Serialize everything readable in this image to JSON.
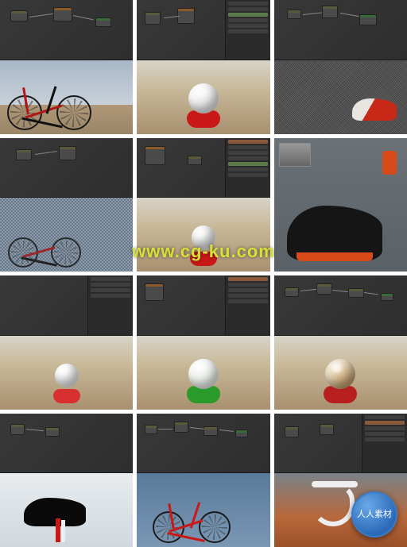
{
  "watermark_text": "www.cg-ku.com",
  "badge_text": "人人素材",
  "cells": [
    {
      "id": "r1c1",
      "desc": "node-editor-bike-render-desert"
    },
    {
      "id": "r1c2",
      "desc": "node-editor-shaderball-red-white"
    },
    {
      "id": "r1c3",
      "desc": "node-editor-bike-saddle-noise"
    },
    {
      "id": "r2c1",
      "desc": "node-editor-bike-pixelated"
    },
    {
      "id": "r2c2",
      "desc": "node-editor-shaderball-red-white-panel"
    },
    {
      "id": "r2c3",
      "desc": "bike-saddle-closeup-black-orange"
    },
    {
      "id": "r3c1",
      "desc": "node-editor-shaderball-white"
    },
    {
      "id": "r3c2",
      "desc": "node-editor-shaderball-green"
    },
    {
      "id": "r3c3",
      "desc": "node-editor-shaderball-tan-metallic"
    },
    {
      "id": "r4c1",
      "desc": "node-editor-saddle-white-red"
    },
    {
      "id": "r4c2",
      "desc": "node-editor-bike-full-red"
    },
    {
      "id": "r4c3",
      "desc": "node-editor-handlebar-white"
    }
  ],
  "shader_balls": {
    "r1c2": {
      "ball_color": "#f0f0f0",
      "stand_color": "#c81818"
    },
    "r2c2": {
      "ball_color": "#f0f0f0",
      "stand_color": "#c81818"
    },
    "r3c1": {
      "ball_color": "#f4f4f4",
      "stand_color": "#d83030"
    },
    "r3c2": {
      "ball_color": "#f0f4f0",
      "stand_color": "#2a9a2a"
    },
    "r3c3": {
      "ball_color": "#c8a878",
      "stand_color": "#b82020"
    }
  }
}
